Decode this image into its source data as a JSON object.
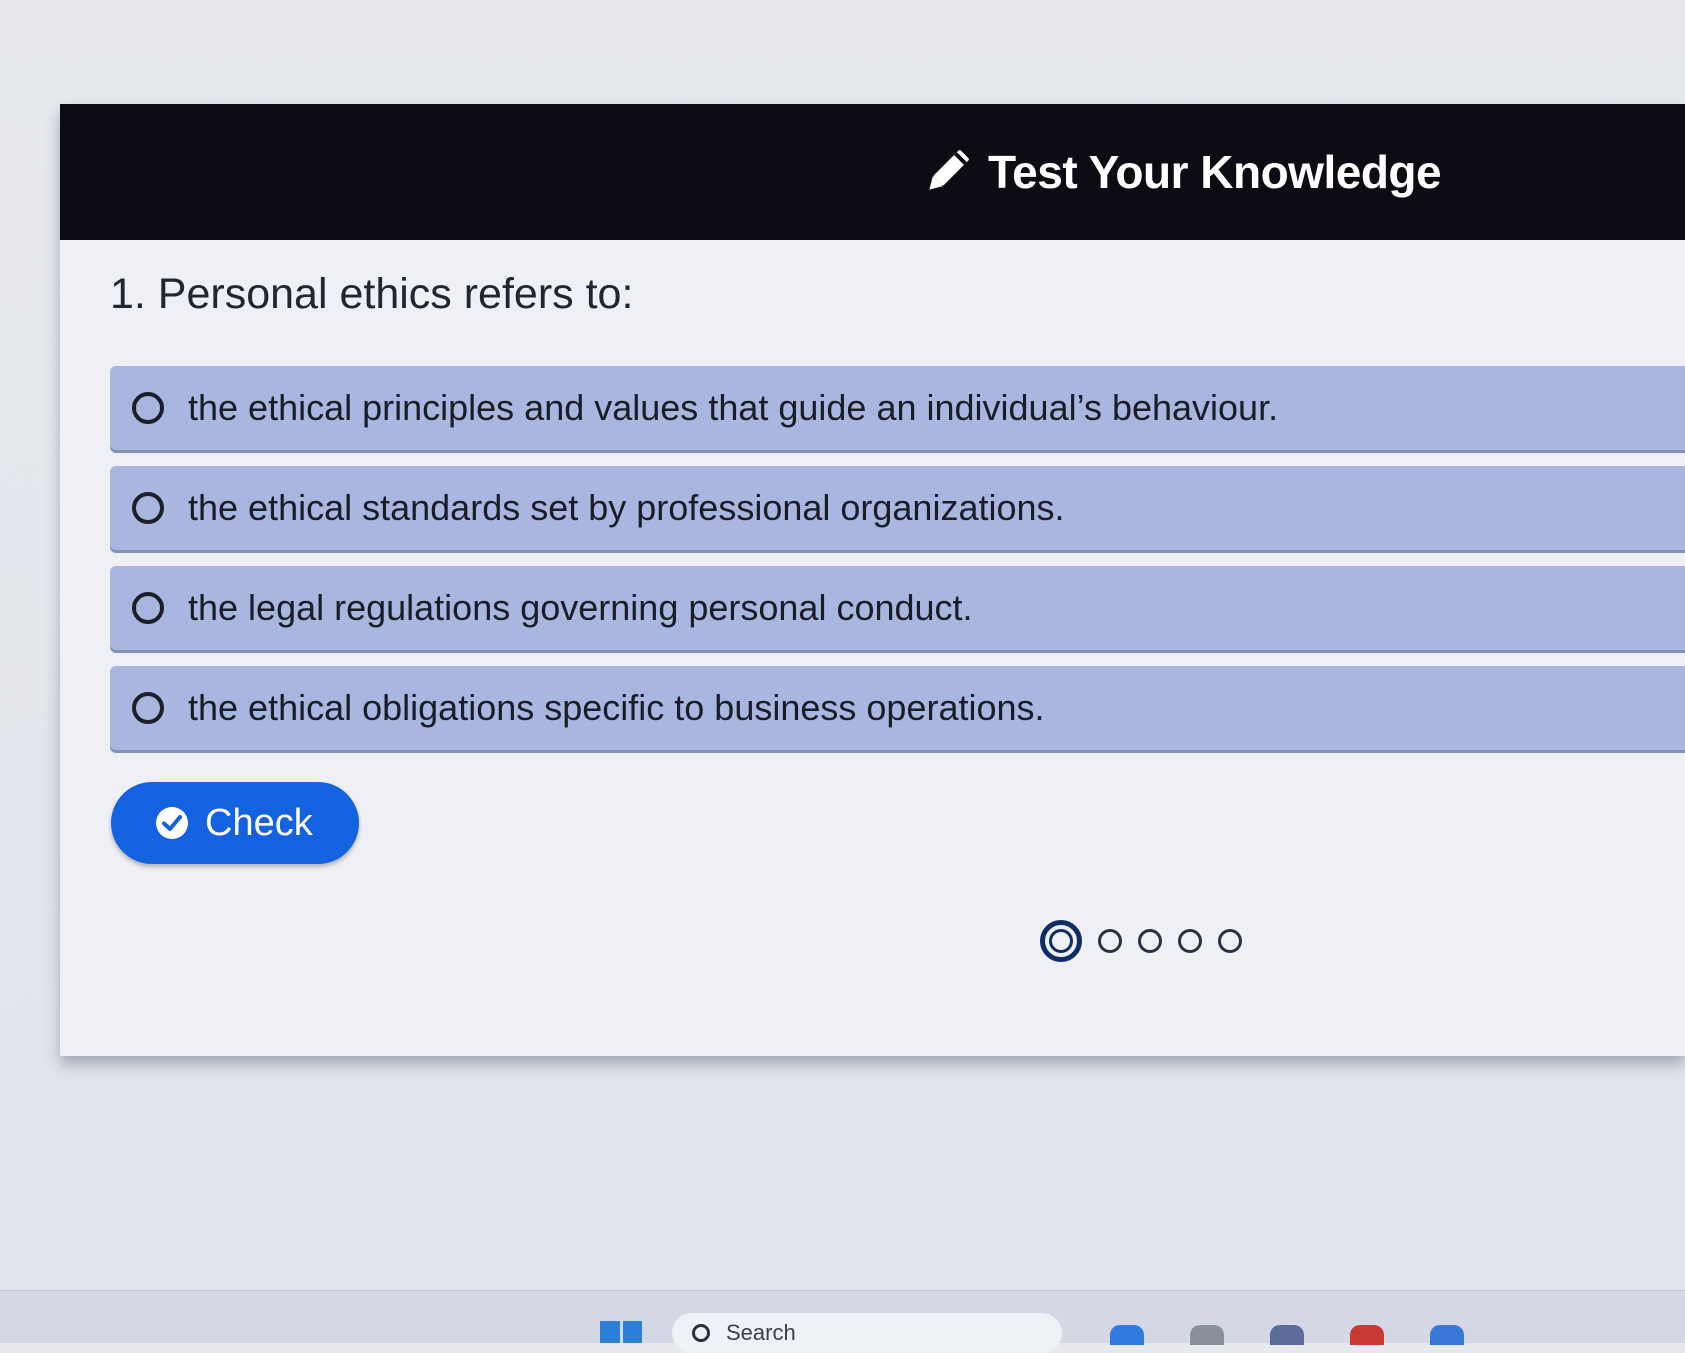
{
  "header": {
    "title": "Test Your Knowledge",
    "icon": "pencil-icon"
  },
  "question": {
    "text": "1. Personal ethics refers to:"
  },
  "options": [
    {
      "label": "the ethical principles and values that guide an individual’s behaviour.",
      "selected": false
    },
    {
      "label": "the ethical standards set by professional organizations.",
      "selected": false
    },
    {
      "label": "the legal regulations governing personal conduct.",
      "selected": false
    },
    {
      "label": "the ethical obligations specific to business operations.",
      "selected": false
    }
  ],
  "check_button": {
    "label": "Check",
    "icon": "check-circle-icon"
  },
  "pagination": {
    "total": 5,
    "current": 1
  },
  "taskbar": {
    "search_label": "Search"
  },
  "colors": {
    "header_bg": "#0c0d14",
    "option_bg": "#a9b7e0",
    "check_button_bg": "#1462e0",
    "card_bg": "#eef0f6"
  }
}
